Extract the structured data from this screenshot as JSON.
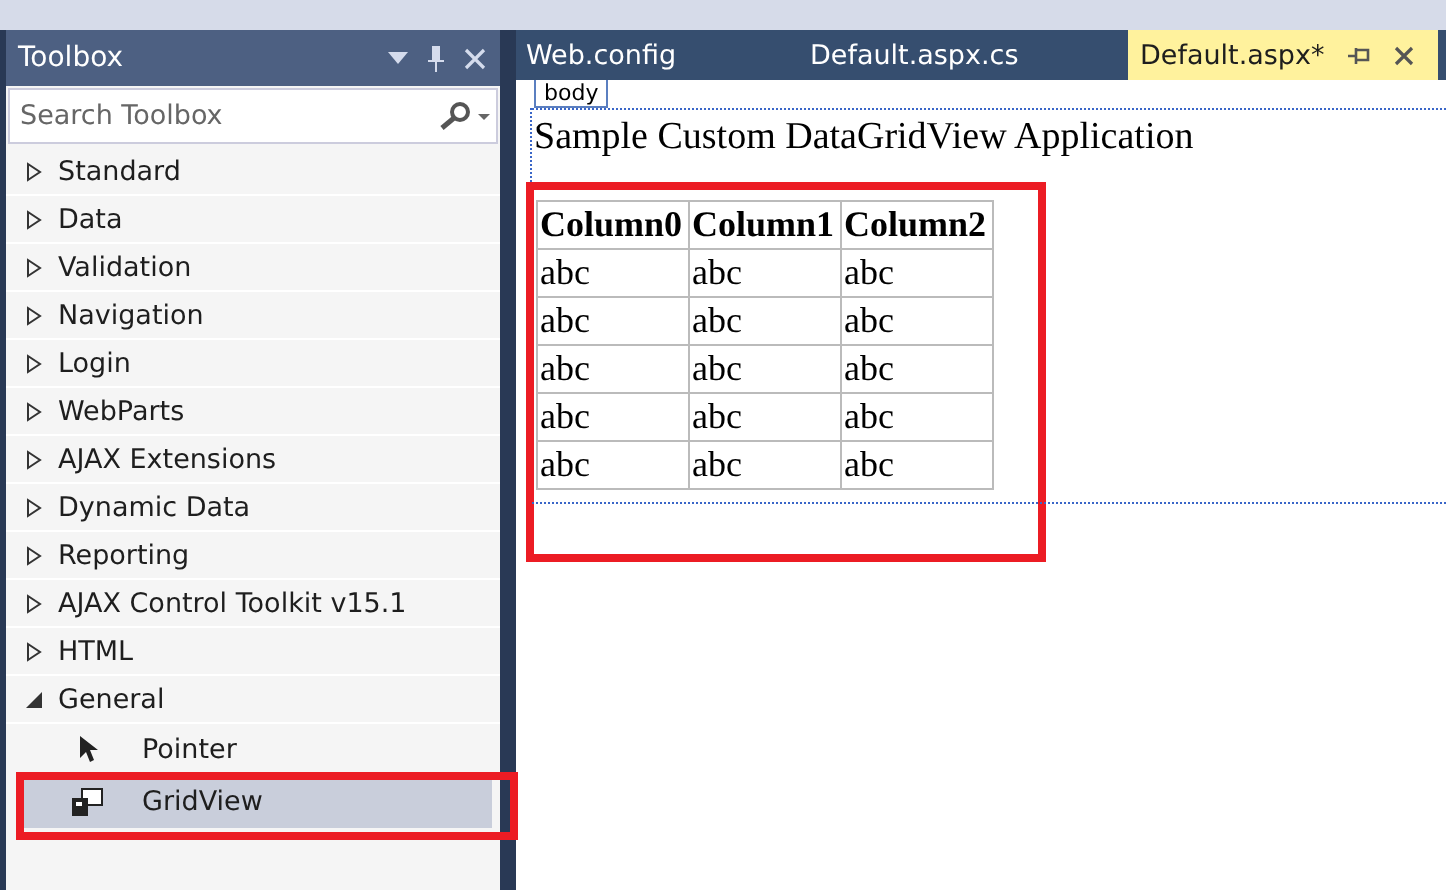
{
  "toolbox": {
    "title": "Toolbox",
    "search": {
      "placeholder": "Search Toolbox"
    },
    "groups": [
      {
        "label": "Standard",
        "expanded": false
      },
      {
        "label": "Data",
        "expanded": false
      },
      {
        "label": "Validation",
        "expanded": false
      },
      {
        "label": "Navigation",
        "expanded": false
      },
      {
        "label": "Login",
        "expanded": false
      },
      {
        "label": "WebParts",
        "expanded": false
      },
      {
        "label": "AJAX Extensions",
        "expanded": false
      },
      {
        "label": "Dynamic Data",
        "expanded": false
      },
      {
        "label": "Reporting",
        "expanded": false
      },
      {
        "label": "AJAX Control Toolkit v15.1",
        "expanded": false
      },
      {
        "label": "HTML",
        "expanded": false
      },
      {
        "label": "General",
        "expanded": true,
        "children": [
          {
            "label": "Pointer",
            "kind": "pointer",
            "selected": false
          },
          {
            "label": "GridView",
            "kind": "grid",
            "selected": true
          }
        ]
      }
    ]
  },
  "tabs": [
    {
      "label": "Web.config",
      "selected": false
    },
    {
      "label": "Default.aspx.cs",
      "selected": false
    },
    {
      "label": "Default.aspx*",
      "selected": true
    }
  ],
  "editor": {
    "tag": "body",
    "heading": "Sample Custom DataGridView Application",
    "table": {
      "columns": [
        "Column0",
        "Column1",
        "Column2"
      ],
      "rows": [
        [
          "abc",
          "abc",
          "abc"
        ],
        [
          "abc",
          "abc",
          "abc"
        ],
        [
          "abc",
          "abc",
          "abc"
        ],
        [
          "abc",
          "abc",
          "abc"
        ],
        [
          "abc",
          "abc",
          "abc"
        ]
      ]
    }
  }
}
